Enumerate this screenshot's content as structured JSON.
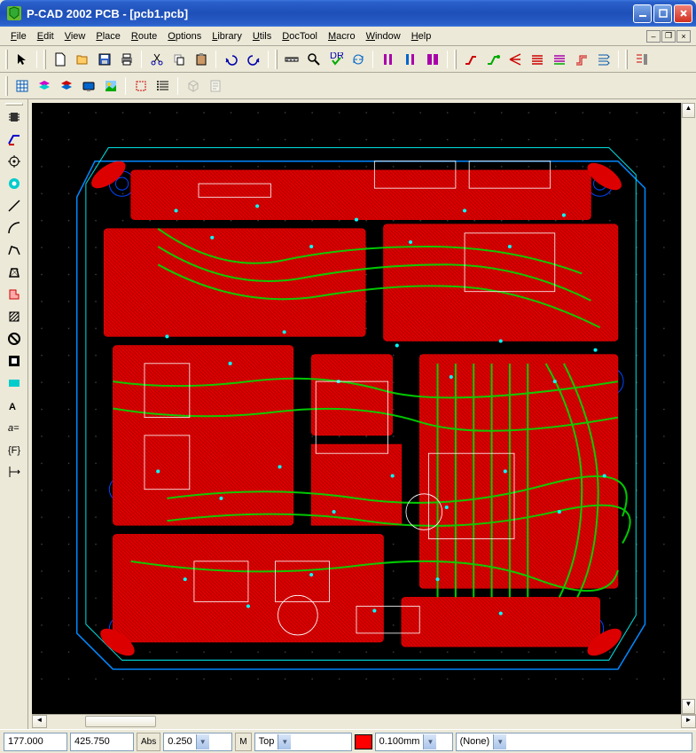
{
  "window": {
    "title": "P-CAD 2002 PCB - [pcb1.pcb]"
  },
  "menus": [
    "File",
    "Edit",
    "View",
    "Place",
    "Route",
    "Options",
    "Library",
    "Utils",
    "DocTool",
    "Macro",
    "Window",
    "Help"
  ],
  "toolbar1": {
    "groups": [
      [
        "select-arrow"
      ],
      [
        "new-file",
        "open-file",
        "save-file",
        "print"
      ],
      [
        "cut",
        "copy",
        "paste"
      ],
      [
        "undo",
        "redo"
      ],
      [
        "measure",
        "zoom",
        "drc",
        "refresh"
      ],
      [
        "bar1",
        "bar2",
        "bar3"
      ],
      [
        "route-manual",
        "route-interactive",
        "route-fanout",
        "route-bus",
        "route-multi",
        "route-miter",
        "route-push"
      ],
      [
        "route-extra"
      ]
    ]
  },
  "toolbar2": {
    "items": [
      "grid-table",
      "layer-stack",
      "layer-color",
      "display-opts",
      "image-view",
      "sel-mask",
      "list-view",
      "3d-view",
      "report"
    ]
  },
  "left_tools": [
    "component",
    "route-n",
    "pad-target",
    "pad-thru",
    "line",
    "arc",
    "poly-open",
    "poly-closed",
    "pour",
    "keepout",
    "prohibit",
    "cutout",
    "rect-tool",
    "text-tool",
    "attr-tool",
    "refpoint",
    "dimension"
  ],
  "status": {
    "x": "177.000",
    "y": "425.750",
    "abs_label": "Abs",
    "grid": "0.250",
    "m_label": "M",
    "layer": "Top",
    "width": "0.100mm",
    "selection": "(None)"
  },
  "colors": {
    "accent": "#2a5fc9",
    "swatch": "#ff0000"
  }
}
